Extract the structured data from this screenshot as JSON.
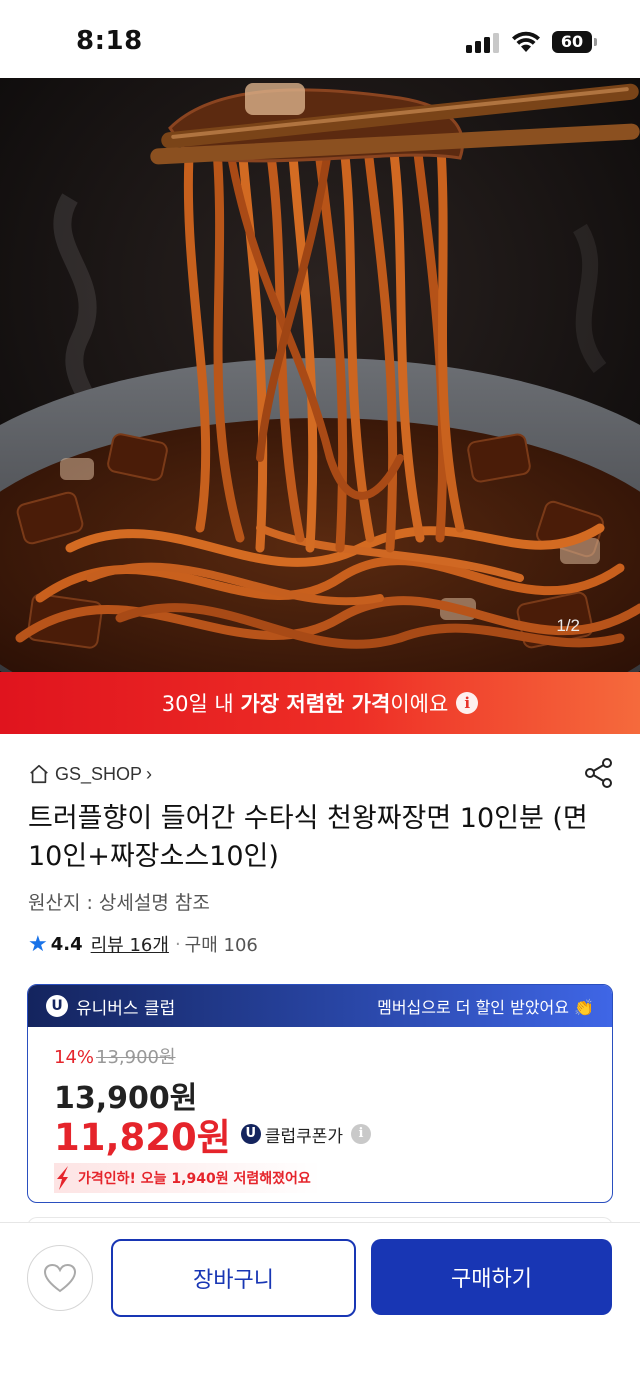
{
  "status_bar": {
    "time": "8:18",
    "battery": "60"
  },
  "hero": {
    "counter": "1/2"
  },
  "promo": {
    "prefix": "30일 내 ",
    "bold": "가장 저렴한 가격",
    "suffix": "이에요",
    "info": "i"
  },
  "seller": {
    "name": "GS_SHOP",
    "chevron": "›"
  },
  "product": {
    "title": "트러플향이 들어간 수타식 천왕짜장면 10인분 (면 10인+짜장소스10인)",
    "origin": "원산지 : 상세설명 참조"
  },
  "rating": {
    "star": "★",
    "score": "4.4",
    "reviews": "리뷰 16개",
    "dot": "·",
    "purchases": "구매 106"
  },
  "club": {
    "badge": "U",
    "name": "유니버스 클럽",
    "member_msg": "멤버십으로 더 할인 받았어요 👏",
    "discount": "14%",
    "original_price": "13,900원",
    "price": "13,900원",
    "club_price": "11,820원",
    "coupon_label": "클럽쿠폰가",
    "coupon_info": "i",
    "drop_msg": "가격인하! 오늘 1,940원 저렴해졌어요"
  },
  "bottom": {
    "cart_label": "장바구니",
    "buy_label": "구매하기"
  },
  "colors": {
    "accent_blue": "#1836b4",
    "promo_red": "#e0141e",
    "price_red": "#e5242b",
    "star_blue": "#1a73e8"
  }
}
